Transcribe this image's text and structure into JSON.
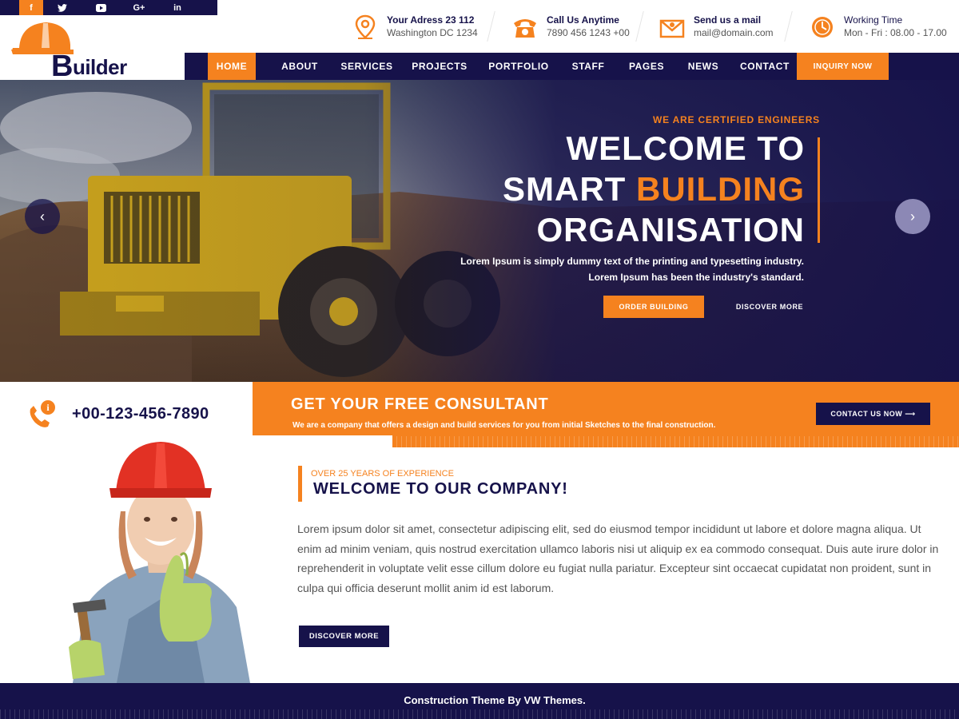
{
  "social": {
    "icons": [
      "facebook-icon",
      "twitter-icon",
      "youtube-icon",
      "google-plus-icon",
      "linkedin-icon"
    ],
    "f": "f",
    "gplus": "G+",
    "in": "in"
  },
  "logo": {
    "initial": "B",
    "rest": "uilder"
  },
  "header": {
    "address_title": "Your Adress 23 112",
    "address_sub": "Washington DC 1234",
    "call_title": "Call Us Anytime",
    "call_sub": "7890 456 1243 +00",
    "mail_title": "Send us a mail",
    "mail_sub": "mail@domain.com",
    "time_title": "Working Time",
    "time_sub": "Mon - Fri : 08.00 - 17.00"
  },
  "nav": {
    "items": [
      "HOME",
      "ABOUT",
      "SERVICES",
      "PROJECTS",
      "PORTFOLIO",
      "STAFF",
      "PAGES",
      "NEWS",
      "CONTACT"
    ],
    "inquiry": "INQUIRY NOW"
  },
  "hero": {
    "eyebrow": "WE ARE CERTIFIED ENGINEERS",
    "line1": "WELCOME TO",
    "line2_a": "SMART ",
    "line2_b": "BUILDING",
    "line3": "ORGANISATION",
    "sub1": "Lorem Ipsum is simply dummy text of the printing and typesetting industry.",
    "sub2": "Lorem Ipsum has been the industry's standard.",
    "btn_order": "ORDER BUILDING",
    "btn_discover": "DISCOVER MORE",
    "prev": "‹",
    "next": "›"
  },
  "phone": {
    "number": "+00-123-456-7890"
  },
  "consult": {
    "title": "GET YOUR FREE CONSULTANT",
    "desc": "We are a company that offers a design and build services for you from initial Sketches to the final construction.",
    "btn": "CONTACT US NOW ⟶"
  },
  "about": {
    "eyebrow": "OVER 25 YEARS OF EXPERIENCE",
    "title": "WELCOME TO OUR COMPANY!",
    "text": "Lorem ipsum dolor sit amet, consectetur adipiscing elit, sed do eiusmod tempor incididunt ut labore et dolore magna aliqua. Ut enim ad minim veniam, quis nostrud exercitation ullamco laboris nisi ut aliquip ex ea commodo consequat. Duis aute irure dolor in reprehenderit in voluptate velit esse cillum dolore eu fugiat nulla pariatur. Excepteur sint occaecat cupidatat non proident, sunt in culpa qui officia deserunt mollit anim id est laborum.",
    "btn": "DISCOVER MORE"
  },
  "footer": {
    "text": "Construction Theme By VW Themes."
  },
  "colors": {
    "navy": "#16124a",
    "orange": "#f5821f"
  }
}
